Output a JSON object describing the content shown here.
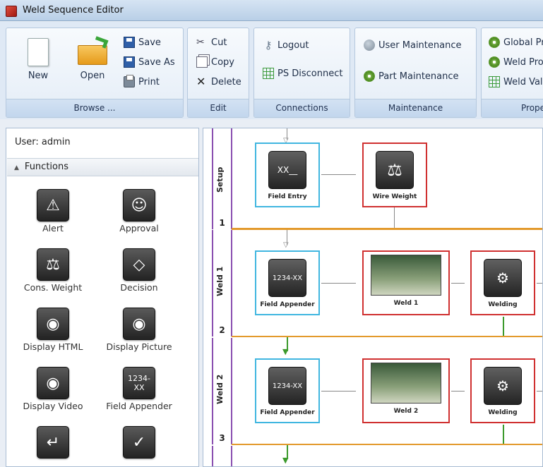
{
  "window": {
    "title": "Weld Sequence Editor"
  },
  "ribbon": {
    "browse": {
      "new": "New",
      "open": "Open",
      "save": "Save",
      "save_as": "Save As",
      "print": "Print",
      "footer": "Browse ..."
    },
    "edit": {
      "cut": "Cut",
      "copy": "Copy",
      "delete": "Delete",
      "footer": "Edit"
    },
    "connections": {
      "logout": "Logout",
      "ps_disconnect": "PS Disconnect",
      "footer": "Connections"
    },
    "maintenance": {
      "user": "User Maintenance",
      "part": "Part Maintenance",
      "footer": "Maintenance"
    },
    "properties": {
      "global": "Global Pr",
      "weld_pro": "Weld Pro",
      "weld_val": "Weld Val",
      "footer": "Proper"
    }
  },
  "sidebar": {
    "user": "User: admin",
    "functions_header": "Functions",
    "tools": [
      {
        "label": "Alert",
        "icon": "alert-icon"
      },
      {
        "label": "Approval",
        "icon": "approval-icon"
      },
      {
        "label": "Cons. Weight",
        "icon": "scale-icon"
      },
      {
        "label": "Decision",
        "icon": "decision-icon"
      },
      {
        "label": "Display HTML",
        "icon": "camera-html-icon"
      },
      {
        "label": "Display Picture",
        "icon": "camera-picture-icon"
      },
      {
        "label": "Display Video",
        "icon": "camera-video-icon"
      },
      {
        "label": "Field Appender",
        "icon": "field-appender-icon",
        "glyph": "1234-XX"
      },
      {
        "label": "",
        "icon": "field-entry-icon"
      },
      {
        "label": "",
        "icon": "check-icon"
      }
    ]
  },
  "canvas": {
    "lanes": [
      {
        "name": "Setup",
        "number": "1"
      },
      {
        "name": "Weld 1",
        "number": "2"
      },
      {
        "name": "Weld 2",
        "number": "3"
      }
    ],
    "nodes": {
      "setup_field_entry": {
        "label": "Field Entry",
        "glyph": "XX__"
      },
      "setup_wire_weight": {
        "label": "Wire Weight"
      },
      "w1_field_appender": {
        "label": "Field Appender",
        "glyph": "1234-XX"
      },
      "w1_weld": {
        "label": "Weld 1"
      },
      "w1_welding": {
        "label": "Welding"
      },
      "w2_field_appender": {
        "label": "Field Appender",
        "glyph": "1234-XX"
      },
      "w2_weld": {
        "label": "Weld 2"
      },
      "w2_welding": {
        "label": "Welding"
      }
    }
  },
  "colors": {
    "lane_border": "#8a4fb0",
    "node_input": "#40b6e0",
    "node_action": "#d03030",
    "transition_orange": "#e39a2c",
    "transition_green": "#3c9a2c"
  }
}
